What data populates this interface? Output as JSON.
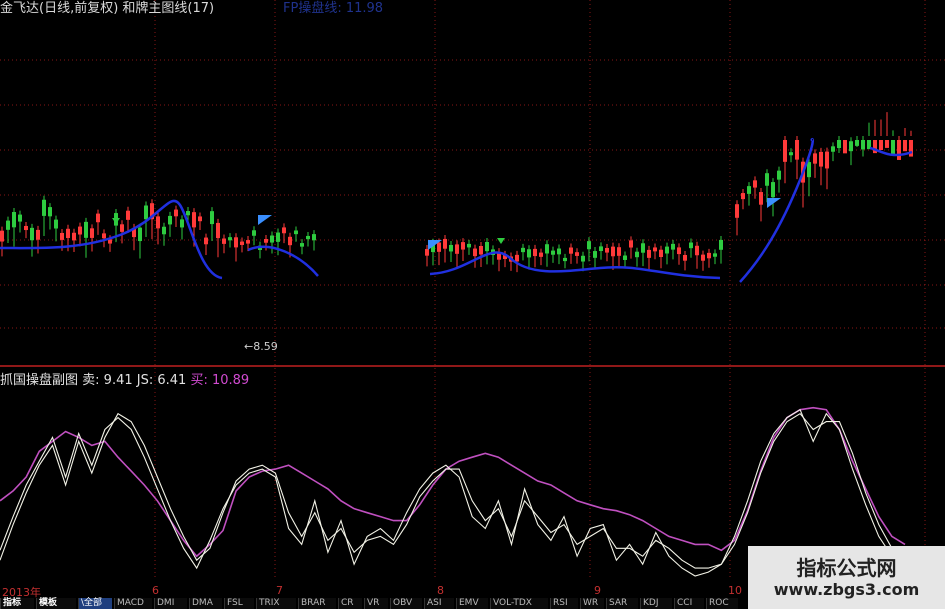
{
  "header": {
    "title": "金飞达(日线,前复权) 和牌主图线(17)",
    "blue_label": "FP操盘线: 11.98"
  },
  "sub_panel": {
    "name": "抓国操盘副图",
    "sell_text": "卖: 9.41",
    "js_text": "JS: 6.41",
    "buy_text": "买: 10.89"
  },
  "low_marker": "8.59",
  "date_axis": [
    "2013年",
    "6",
    "7",
    "8",
    "9",
    "10"
  ],
  "tabs": [
    "指标",
    "模板",
    "\\全部",
    "MACD",
    "DMI",
    "DMA",
    "FSL",
    "TRIX",
    "BRAR",
    "CR",
    "VR",
    "OBV",
    "ASI",
    "EMV",
    "VOL-TDX",
    "RSI",
    "WR",
    "SAR",
    "KDJ",
    "CCI",
    "ROC"
  ],
  "active_tab_index": 2,
  "watermark": {
    "title": "指标公式网",
    "url": "www.zbgs3.com"
  },
  "colors": {
    "background": "#000000",
    "divider": "#c02020",
    "grid": "#c02020",
    "up_candle": "#ff3a3a",
    "down_candle": "#2ecc40",
    "trend_line": "#2030e0",
    "k_line": "#f2f2e6",
    "d_line": "#c050c0"
  },
  "chart_data": {
    "type": "line",
    "note": "Main panel: candlesticks with trend line; sub panel: oscillator in 0-100 scale",
    "series": [
      {
        "values": [
          40,
          45,
          52,
          65,
          70,
          75,
          72,
          68,
          70,
          62,
          55,
          48,
          40,
          30,
          20,
          12,
          18,
          25,
          45,
          52,
          55,
          56,
          58,
          54,
          50,
          46,
          40,
          36,
          34,
          32,
          30,
          30,
          38,
          48,
          56,
          60,
          62,
          64,
          62,
          58,
          54,
          50,
          48,
          44,
          40,
          38,
          36,
          35,
          33,
          30,
          26,
          22,
          20,
          18,
          18,
          15,
          20,
          35,
          55,
          72,
          82,
          86,
          87,
          86,
          76,
          60,
          46,
          32,
          22,
          18
        ]
      },
      {
        "values": [
          15,
          32,
          48,
          60,
          72,
          52,
          74,
          58,
          76,
          82,
          76,
          62,
          46,
          30,
          16,
          6,
          20,
          36,
          48,
          54,
          56,
          52,
          26,
          18,
          40,
          14,
          30,
          8,
          22,
          26,
          20,
          34,
          46,
          54,
          58,
          52,
          32,
          26,
          40,
          18,
          46,
          28,
          20,
          32,
          12,
          26,
          28,
          10,
          18,
          8,
          24,
          12,
          6,
          2,
          4,
          8,
          22,
          40,
          60,
          74,
          82,
          86,
          70,
          84,
          76,
          56,
          38,
          22,
          12,
          8
        ]
      },
      {
        "values": [
          10,
          28,
          44,
          58,
          68,
          48,
          70,
          54,
          72,
          84,
          80,
          68,
          52,
          36,
          22,
          10,
          16,
          34,
          50,
          56,
          58,
          54,
          34,
          22,
          34,
          20,
          26,
          14,
          20,
          22,
          18,
          28,
          42,
          50,
          56,
          56,
          40,
          30,
          36,
          22,
          40,
          32,
          24,
          28,
          18,
          22,
          26,
          16,
          16,
          12,
          20,
          16,
          10,
          6,
          6,
          8,
          18,
          34,
          54,
          70,
          80,
          84,
          76,
          80,
          80,
          64,
          44,
          28,
          16,
          10
        ]
      }
    ]
  }
}
